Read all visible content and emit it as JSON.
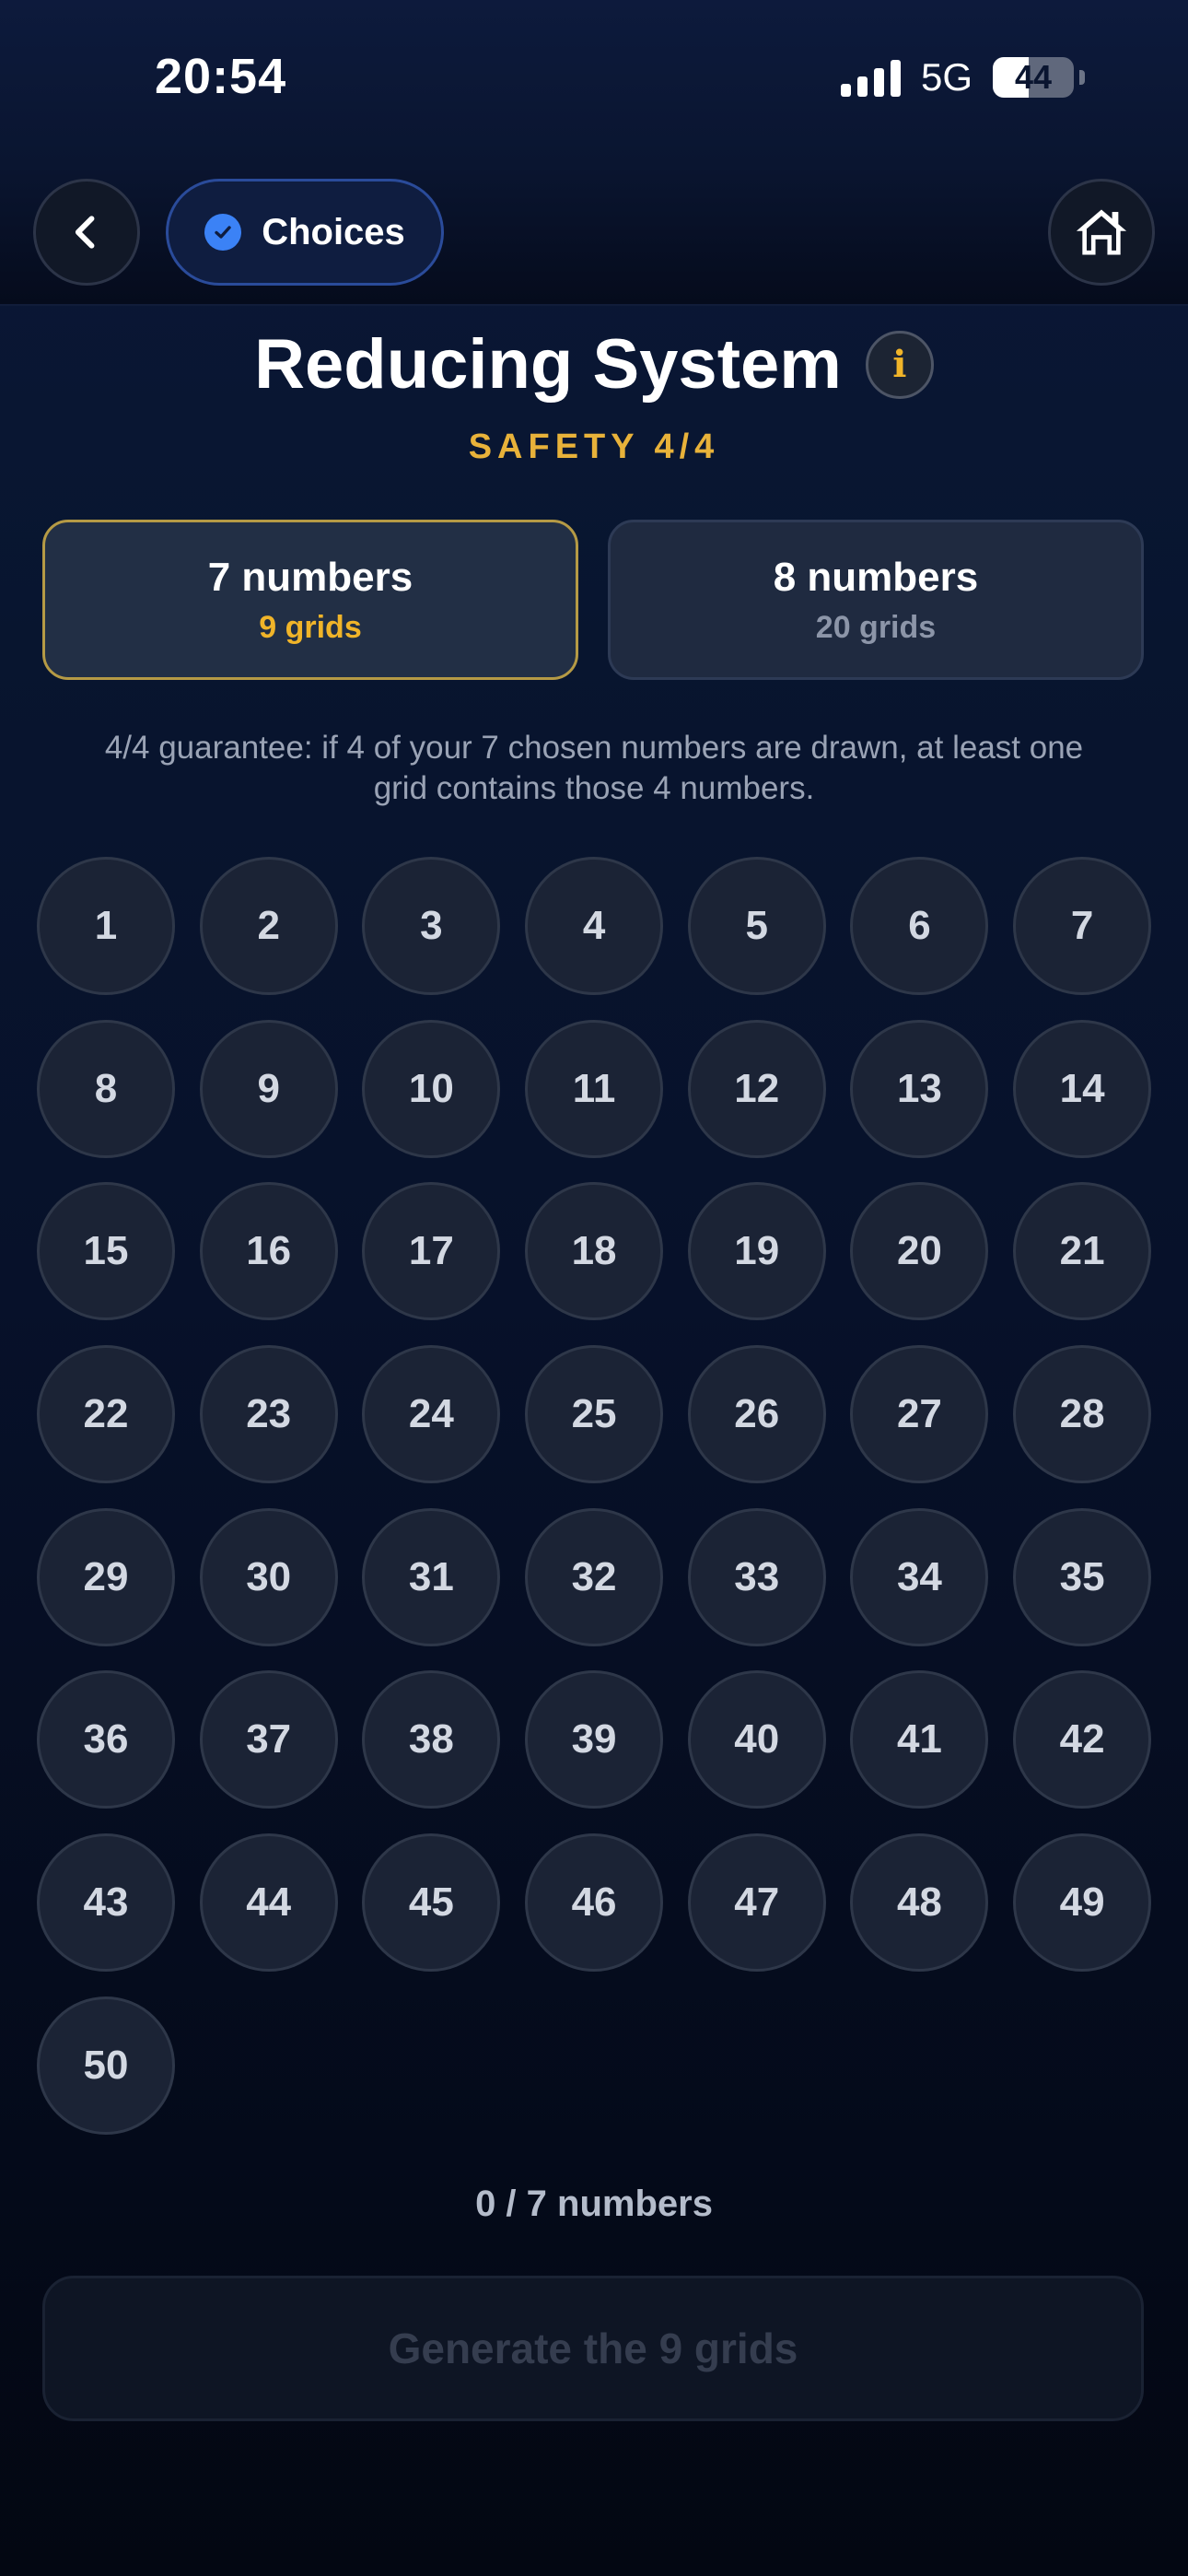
{
  "status_bar": {
    "time": "20:54",
    "network": "5G",
    "battery": "44",
    "battery_level_percent": 44
  },
  "nav": {
    "choices_label": "Choices",
    "icons": {
      "back": "chevron-left-icon",
      "home": "home-icon",
      "check": "check-circle-icon"
    }
  },
  "header": {
    "title": "Reducing System",
    "info_glyph": "i",
    "subtitle": "SAFETY 4/4"
  },
  "options": [
    {
      "title": "7 numbers",
      "sub": "9 grids",
      "selected": true
    },
    {
      "title": "8 numbers",
      "sub": "20 grids",
      "selected": false
    }
  ],
  "description": "4/4 guarantee: if 4 of your 7 chosen numbers are drawn, at least one grid contains those 4 numbers.",
  "numbers": [
    "1",
    "2",
    "3",
    "4",
    "5",
    "6",
    "7",
    "8",
    "9",
    "10",
    "11",
    "12",
    "13",
    "14",
    "15",
    "16",
    "17",
    "18",
    "19",
    "20",
    "21",
    "22",
    "23",
    "24",
    "25",
    "26",
    "27",
    "28",
    "29",
    "30",
    "31",
    "32",
    "33",
    "34",
    "35",
    "36",
    "37",
    "38",
    "39",
    "40",
    "41",
    "42",
    "43",
    "44",
    "45",
    "46",
    "47",
    "48",
    "49",
    "50"
  ],
  "counter": "0 / 7 numbers",
  "generate_label": "Generate the 9 grids",
  "colors": {
    "accent_gold": "#f0b429",
    "accent_blue": "#3b82f6",
    "background": "#07112a"
  }
}
